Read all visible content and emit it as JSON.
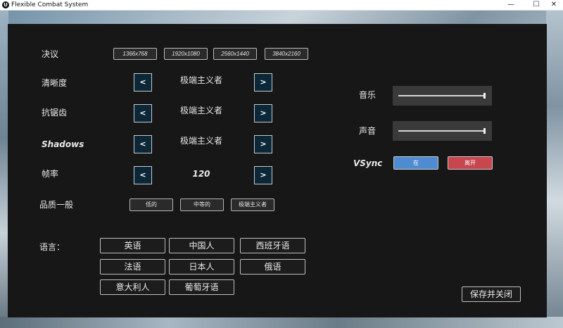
{
  "window": {
    "title": "Flexible Combat System",
    "icon_glyph": "U",
    "minimize": "—",
    "maximize": "☐",
    "close": "✕"
  },
  "settings": {
    "resolution": {
      "label": "决议",
      "options": [
        "1366x768",
        "1920x1080",
        "2560x1440",
        "3840x2160"
      ]
    },
    "texture": {
      "label": "清晰度",
      "value": "极端主义者",
      "prev": "<",
      "next": ">"
    },
    "antialiasing": {
      "label": "抗锯齿",
      "value": "极端主义者",
      "prev": "<",
      "next": ">"
    },
    "shadows": {
      "label": "Shadows",
      "value": "极端主义者",
      "prev": "<",
      "next": ">"
    },
    "framerate": {
      "label": "帧率",
      "value": "120",
      "prev": "<",
      "next": ">"
    },
    "quality": {
      "label": "品质一般",
      "options": [
        "低的",
        "中等的",
        "极端主义者"
      ]
    },
    "language": {
      "label": "语言：",
      "options": [
        "英语",
        "中国人",
        "西班牙语",
        "法语",
        "日本人",
        "俄语",
        "意大利人",
        "葡萄牙语"
      ]
    },
    "music": {
      "label": "音乐",
      "level": 1.0
    },
    "sound": {
      "label": "声音",
      "level": 1.0
    },
    "vsync": {
      "label": "VSync",
      "on_label": "在",
      "off_label": "离开",
      "on_color": "#4f8bd1",
      "off_color": "#c8474f"
    },
    "save_label": "保存并关闭"
  }
}
